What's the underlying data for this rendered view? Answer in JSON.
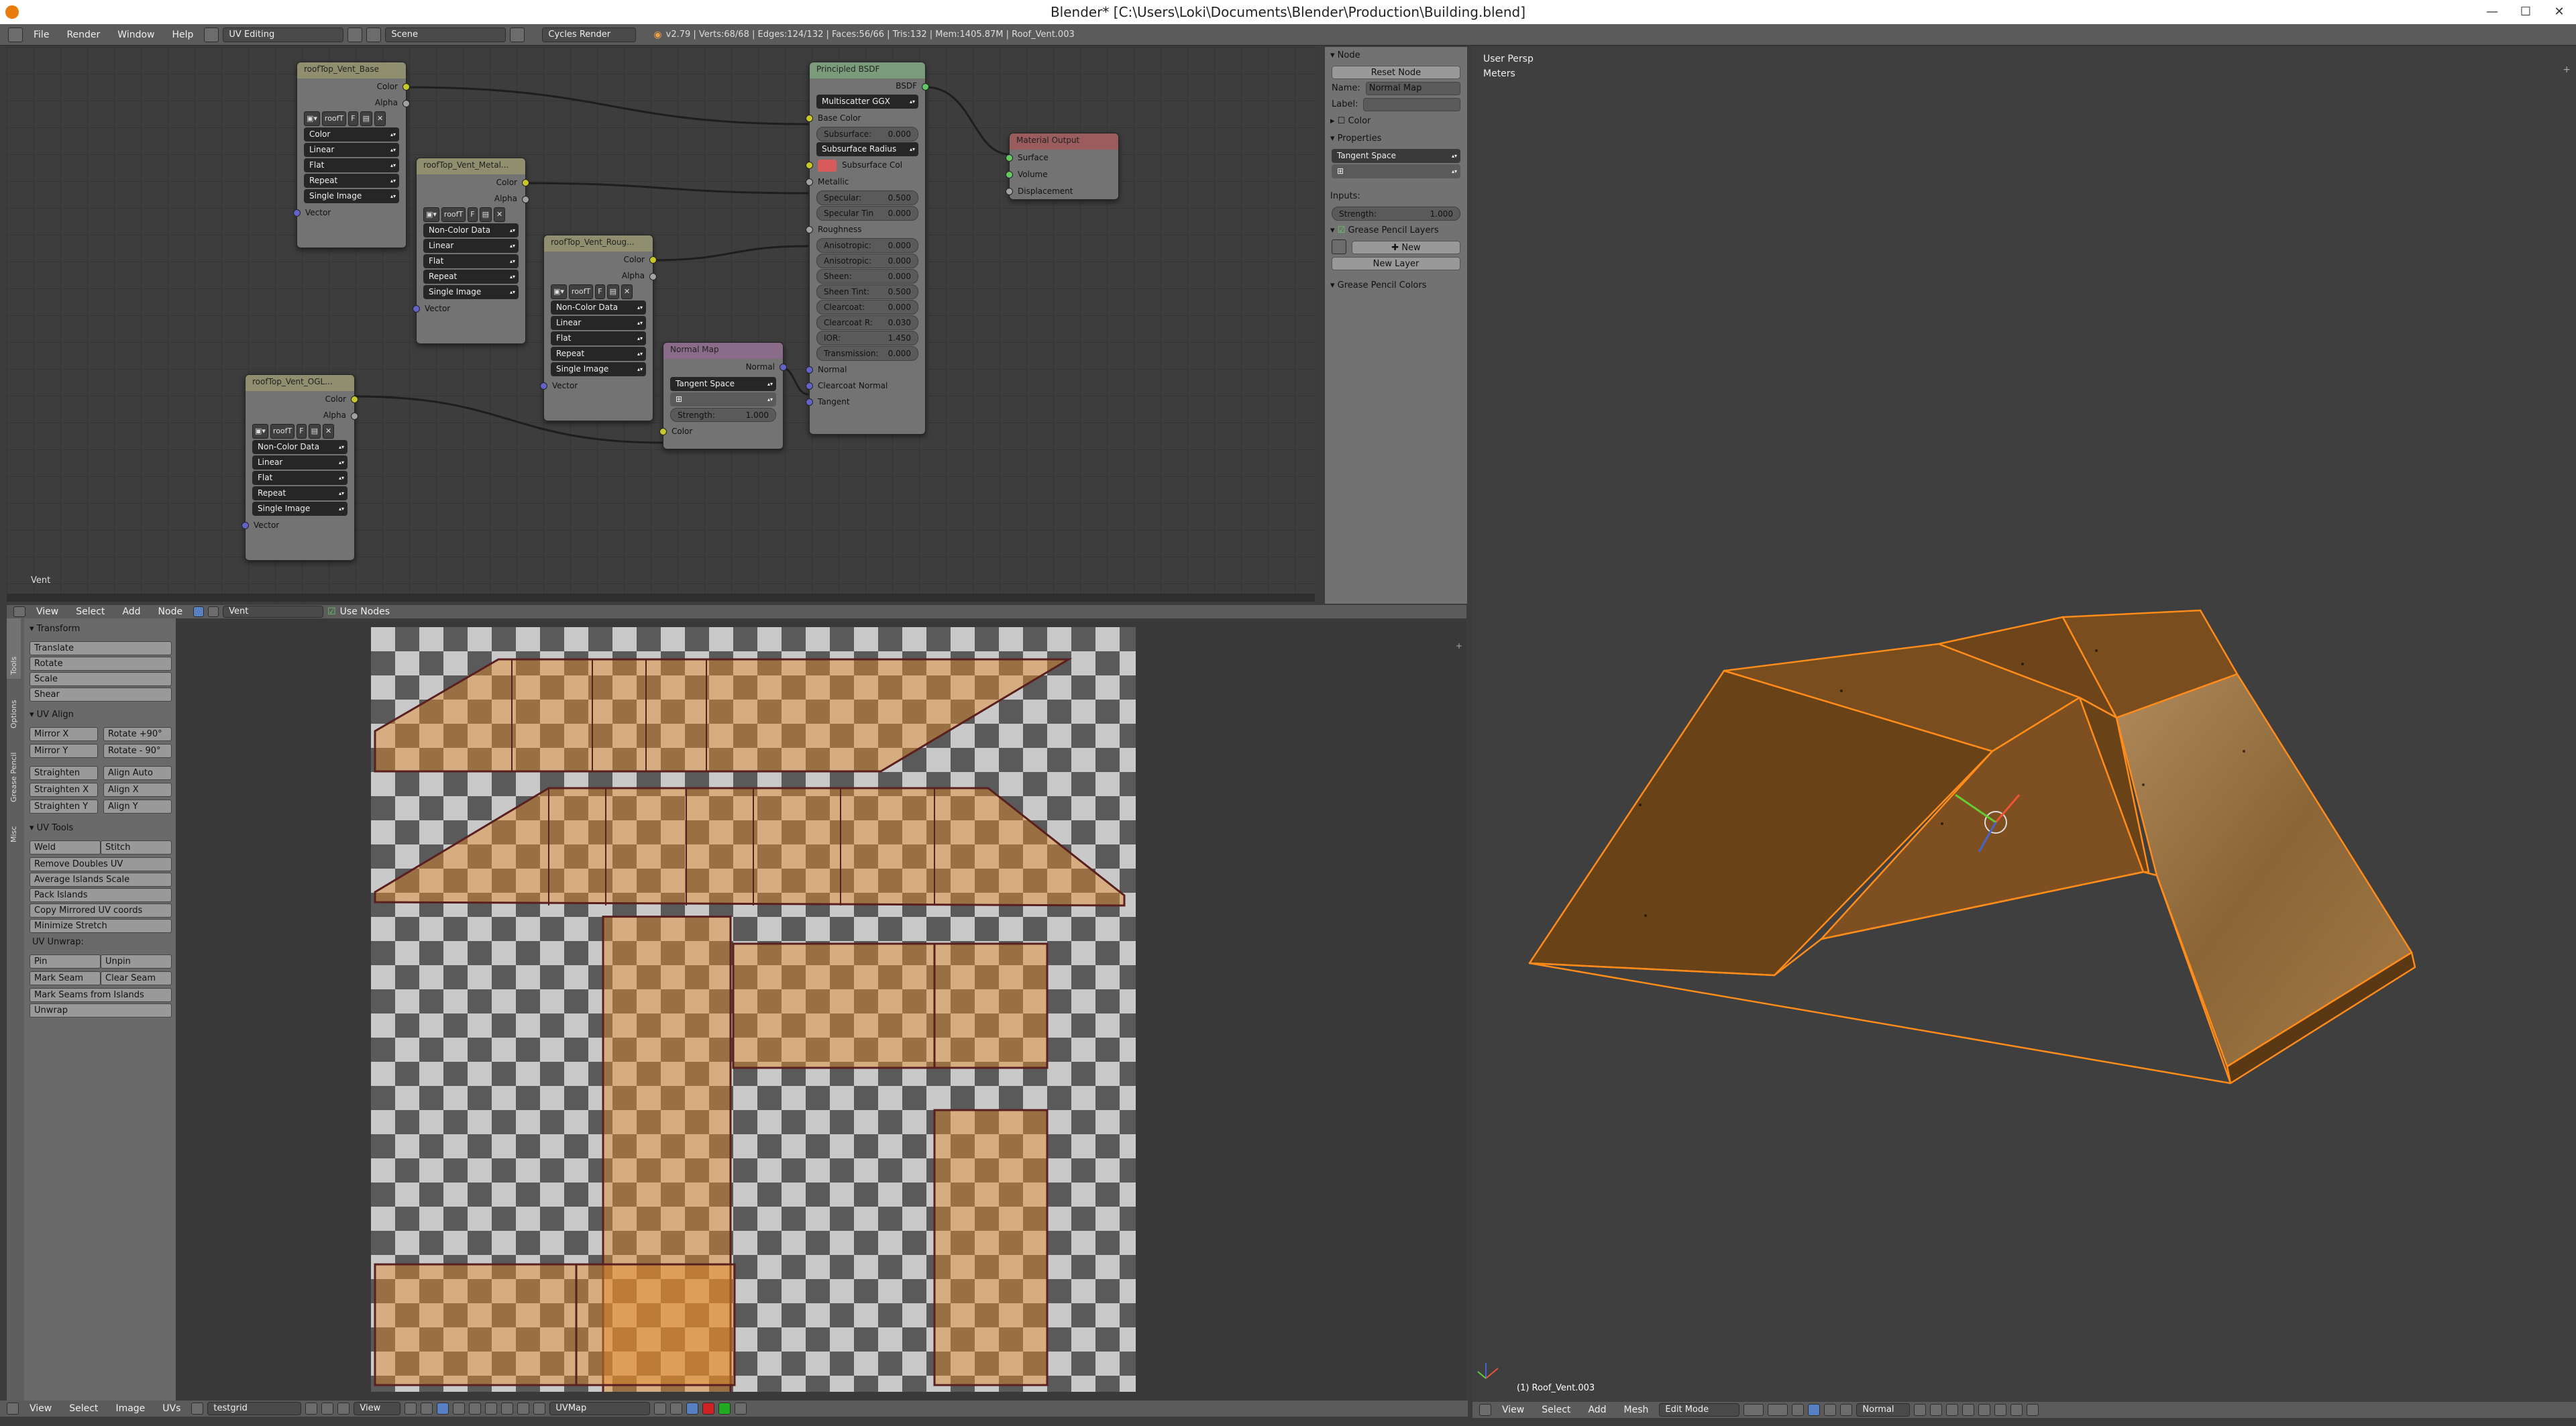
{
  "window": {
    "title": "Blender* [C:\\Users\\Loki\\Documents\\Blender\\Production\\Building.blend]"
  },
  "info_header": {
    "menus": [
      "File",
      "Render",
      "Window",
      "Help"
    ],
    "screen_layout": "UV Editing",
    "scene": "Scene",
    "render_engine": "Cycles Render",
    "stats": "v2.79 | Verts:68/68 | Edges:124/132 | Faces:56/66 | Tris:132 | Mem:1405.87M | Roof_Vent.003"
  },
  "node_editor": {
    "material_label": "Vent",
    "nodes": {
      "tex_base": {
        "title": "roofTop_Vent_Base",
        "out1": "Color",
        "out2": "Alpha",
        "image": "roofT",
        "img_users": "F",
        "color_space": "Color",
        "interp": "Linear",
        "proj": "Flat",
        "ext": "Repeat",
        "source": "Single Image",
        "in_vector": "Vector"
      },
      "tex_metal": {
        "title": "roofTop_Vent_Metal...",
        "out1": "Color",
        "out2": "Alpha",
        "image": "roofT",
        "img_users": "F",
        "color_space": "Non-Color Data",
        "interp": "Linear",
        "proj": "Flat",
        "ext": "Repeat",
        "source": "Single Image",
        "in_vector": "Vector"
      },
      "tex_rough": {
        "title": "roofTop_Vent_Roug...",
        "out1": "Color",
        "out2": "Alpha",
        "image": "roofT",
        "img_users": "F",
        "color_space": "Non-Color Data",
        "interp": "Linear",
        "proj": "Flat",
        "ext": "Repeat",
        "source": "Single Image",
        "in_vector": "Vector"
      },
      "tex_ogl": {
        "title": "roofTop_Vent_OGL...",
        "out1": "Color",
        "out2": "Alpha",
        "image": "roofT",
        "img_users": "F",
        "color_space": "Non-Color Data",
        "interp": "Linear",
        "proj": "Flat",
        "ext": "Repeat",
        "source": "Single Image",
        "in_vector": "Vector"
      },
      "normal_map": {
        "title": "Normal Map",
        "out": "Normal",
        "space": "Tangent Space",
        "strength_label": "Strength:",
        "strength": "1.000",
        "in_color": "Color"
      },
      "bsdf": {
        "title": "Principled BSDF",
        "out": "BSDF",
        "distribution": "Multiscatter GGX",
        "rows": [
          {
            "label": "Base Color",
            "type": "socket"
          },
          {
            "label": "Subsurface:",
            "value": "0.000",
            "type": "field"
          },
          {
            "label": "Subsurface Radius",
            "type": "dropdown"
          },
          {
            "label": "Subsurface Col",
            "type": "color"
          },
          {
            "label": "Metallic",
            "type": "socket"
          },
          {
            "label": "Specular:",
            "value": "0.500",
            "type": "field"
          },
          {
            "label": "Specular Tin",
            "value": "0.000",
            "type": "field"
          },
          {
            "label": "Roughness",
            "type": "socket"
          },
          {
            "label": "Anisotropic:",
            "value": "0.000",
            "type": "field"
          },
          {
            "label": "Anisotropic:",
            "value": "0.000",
            "type": "field"
          },
          {
            "label": "Sheen:",
            "value": "0.000",
            "type": "field"
          },
          {
            "label": "Sheen Tint:",
            "value": "0.500",
            "type": "field"
          },
          {
            "label": "Clearcoat:",
            "value": "0.000",
            "type": "field"
          },
          {
            "label": "Clearcoat R:",
            "value": "0.030",
            "type": "field"
          },
          {
            "label": "IOR:",
            "value": "1.450",
            "type": "field"
          },
          {
            "label": "Transmission:",
            "value": "0.000",
            "type": "field"
          },
          {
            "label": "Normal",
            "type": "socket"
          },
          {
            "label": "Clearcoat Normal",
            "type": "socket"
          },
          {
            "label": "Tangent",
            "type": "socket"
          }
        ]
      },
      "output": {
        "title": "Material Output",
        "in1": "Surface",
        "in2": "Volume",
        "in3": "Displacement"
      }
    }
  },
  "node_props": {
    "section_node": "Node",
    "reset": "Reset Node",
    "name_label": "Name:",
    "name_value": "Normal Map",
    "label_label": "Label:",
    "color_section": "Color",
    "properties_section": "Properties",
    "space": "Tangent Space",
    "inputs_label": "Inputs:",
    "strength_label": "Strength:",
    "strength": "1.000",
    "gp_layers": "Grease Pencil Layers",
    "new": "New",
    "new_layer": "New Layer",
    "gp_colors": "Grease Pencil Colors"
  },
  "node_header": {
    "menus": [
      "View",
      "Select",
      "Add",
      "Node"
    ],
    "material": "Vent",
    "use_nodes": "Use Nodes"
  },
  "uv_tools": {
    "transform": "Transform",
    "transform_btns": [
      "Translate",
      "Rotate",
      "Scale",
      "Shear"
    ],
    "uv_align": "UV Align",
    "align_pairs": [
      [
        "Mirror X",
        "Rotate +90°"
      ],
      [
        "Mirror Y",
        "Rotate - 90°"
      ],
      [
        "Straighten",
        "Align Auto"
      ],
      [
        "Straighten X",
        "Align X"
      ],
      [
        "Straighten Y",
        "Align Y"
      ]
    ],
    "uv_tools_title": "UV Tools",
    "weld": "Weld",
    "stitch": "Stitch",
    "tool_btns": [
      "Remove Doubles UV",
      "Average Islands Scale",
      "Pack Islands",
      "Copy Mirrored UV coords",
      "Minimize Stretch"
    ],
    "unwrap_label": "UV Unwrap:",
    "pin": "Pin",
    "unpin": "Unpin",
    "mark_seam": "Mark Seam",
    "clear_seam": "Clear Seam",
    "seams_islands": "Mark Seams from Islands",
    "unwrap": "Unwrap",
    "side_tabs": [
      "Tools",
      "Options",
      "Grease Pencil",
      "Misc"
    ]
  },
  "uv_header": {
    "menus": [
      "View",
      "Select",
      "Image",
      "UVs"
    ],
    "image": "testgrid",
    "view": "View",
    "uvmap": "UVMap"
  },
  "view3d": {
    "view_name": "User Persp",
    "units": "Meters",
    "object_label": "(1) Roof_Vent.003"
  },
  "view3d_header": {
    "menus": [
      "View",
      "Select",
      "Add",
      "Mesh"
    ],
    "mode": "Edit Mode",
    "pivot": "Normal"
  },
  "colors": {
    "accent": "#e87d0d",
    "selection": "#ff8c1a",
    "mesh_face": "#7a4d1f"
  }
}
